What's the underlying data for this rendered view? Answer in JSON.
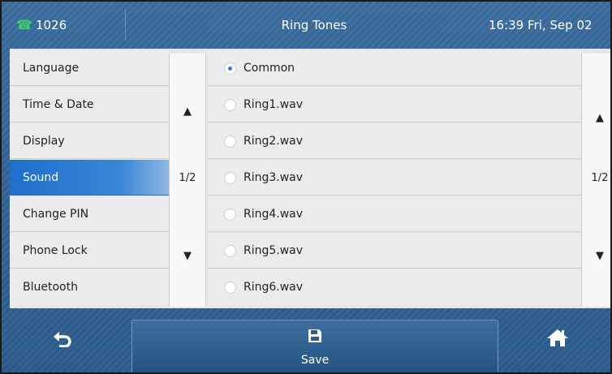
{
  "status_bar": {
    "account": "1026",
    "title": "Ring Tones",
    "datetime": "16:39 Fri, Sep 02",
    "phone_icon": "phone-handset-icon"
  },
  "menu": {
    "items": [
      {
        "label": "Language"
      },
      {
        "label": "Time & Date"
      },
      {
        "label": "Display"
      },
      {
        "label": "Sound",
        "selected": true
      },
      {
        "label": "Change PIN"
      },
      {
        "label": "Phone Lock"
      },
      {
        "label": "Bluetooth"
      }
    ],
    "page": "1/2"
  },
  "ringtones": {
    "items": [
      {
        "label": "Common",
        "checked": true
      },
      {
        "label": "Ring1.wav"
      },
      {
        "label": "Ring2.wav"
      },
      {
        "label": "Ring3.wav"
      },
      {
        "label": "Ring4.wav"
      },
      {
        "label": "Ring5.wav"
      },
      {
        "label": "Ring6.wav"
      }
    ],
    "page": "1/2"
  },
  "softkeys": {
    "back_icon": "back-arrow-icon",
    "save_label": "Save",
    "save_icon": "floppy-disk-icon",
    "home_icon": "home-icon"
  },
  "colors": {
    "selected": "#1d6fcc",
    "radio_dot": "#2a7fd6",
    "phone_icon": "#3fd06a",
    "background": "#2f5f8f"
  }
}
